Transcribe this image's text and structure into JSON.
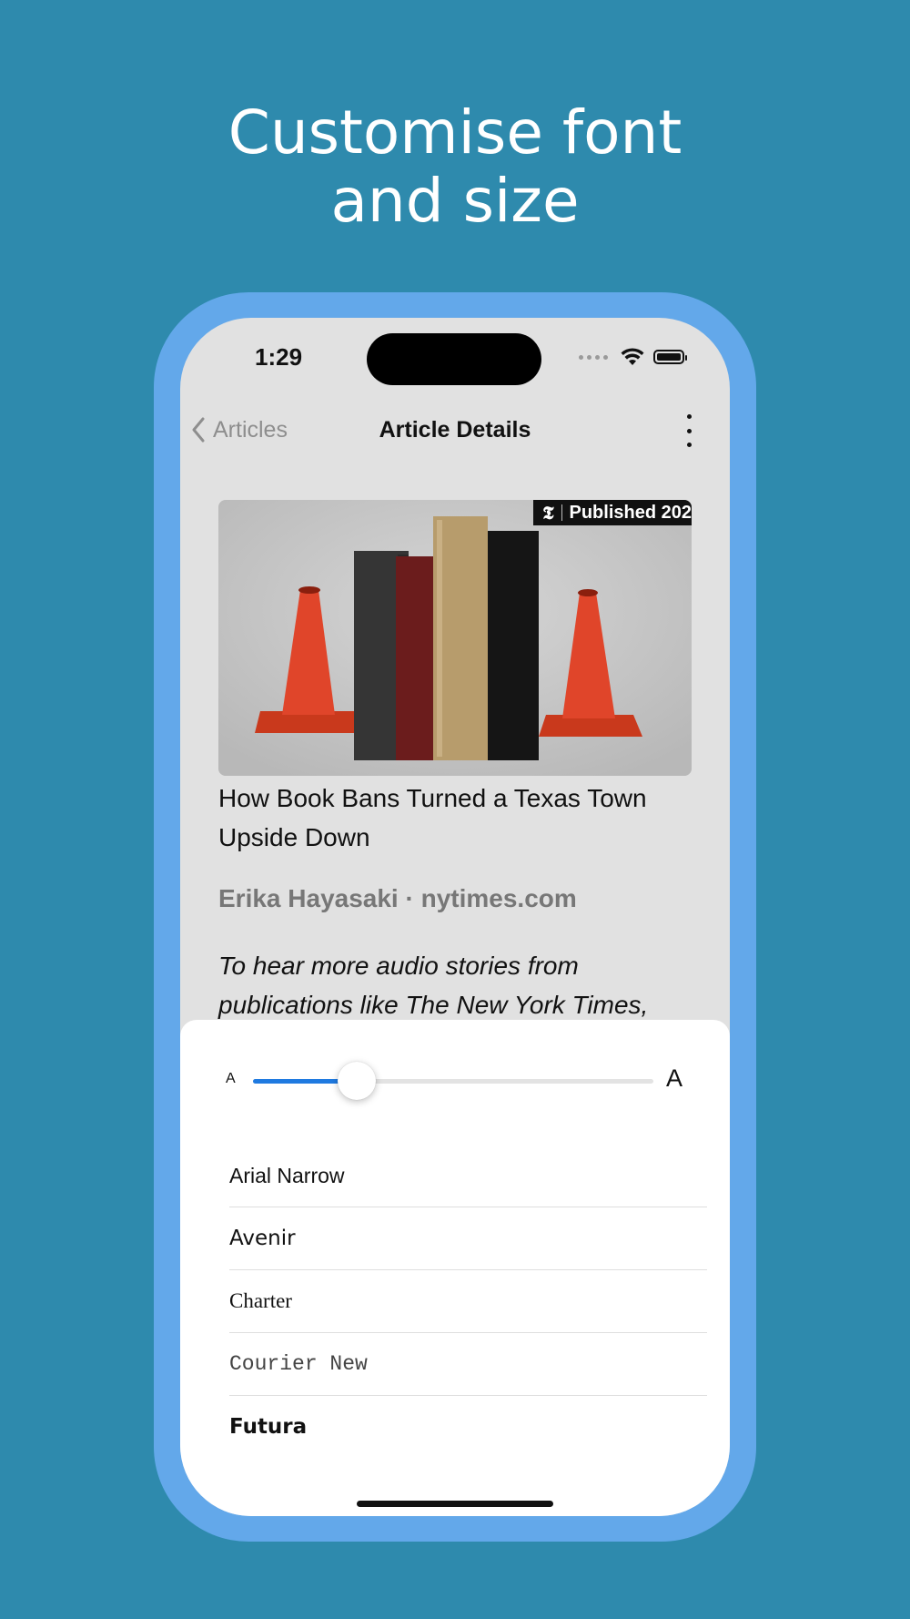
{
  "promo": {
    "line1": "Customise font",
    "line2": "and size"
  },
  "status_bar": {
    "time": "1:29"
  },
  "nav": {
    "back_label": "Articles",
    "title": "Article Details"
  },
  "article": {
    "badge_text": "Published 202",
    "title": "How Book Bans Turned a Texas Town Upside Down",
    "byline": "Erika Hayasaki · nytimes.com",
    "intro": "To hear more audio stories from publications like The New York Times,"
  },
  "text_settings": {
    "size_small_label": "A",
    "size_large_label": "A",
    "size_level": 0.26,
    "accent_color": "#1f7ae0",
    "fonts": [
      "Arial Narrow",
      "Avenir",
      "Charter",
      "Courier New",
      "Futura"
    ]
  }
}
